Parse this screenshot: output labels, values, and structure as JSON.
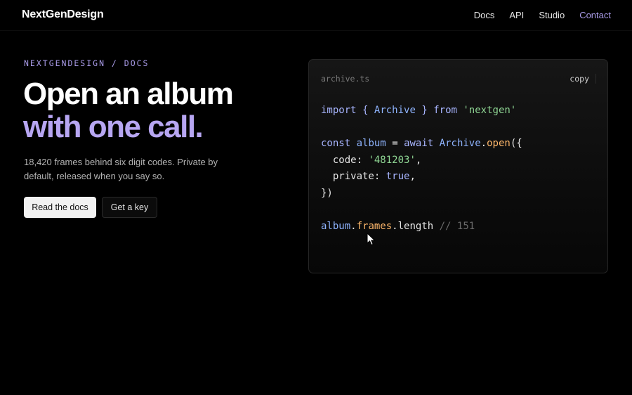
{
  "nav": {
    "brand": "NextGenDesign",
    "links": [
      {
        "label": "Docs"
      },
      {
        "label": "API"
      },
      {
        "label": "Studio"
      },
      {
        "label": "Contact"
      }
    ]
  },
  "hero": {
    "eyebrow": "NEXTGENDESIGN / DOCS",
    "headline_line1": "Open an album",
    "headline_line2": "with one call.",
    "subtitle": "18,420 frames behind six digit codes. Private by default, released when you say so.",
    "primary_button": "Read the docs",
    "secondary_button": "Get a key"
  },
  "code_card": {
    "filename": "archive.ts",
    "copy_label": "copy",
    "tokens": {
      "import": "import",
      "open_brace": "{",
      "archive_1": "Archive",
      "close_brace": "}",
      "from": "from",
      "module": "'nextgen'",
      "const": "const",
      "album_1": "album",
      "eq": "=",
      "await": "await",
      "archive_2": "Archive",
      "dot_1": ".",
      "open": "open",
      "open_call": "({",
      "code_key": "code:",
      "code_val": "'481203'",
      "comma_1": ",",
      "private_key": "private:",
      "true": "true",
      "comma_2": ",",
      "close_call": "})",
      "album_2": "album",
      "dot_2": ".",
      "frames": "frames",
      "length": ".length",
      "comment": "// 151"
    }
  },
  "colors": {
    "accent": "#a99be8",
    "headline_accent": "#b7a6f2",
    "background": "#000000",
    "card_border": "#262626",
    "string": "#8fd694",
    "function": "#ffb86b",
    "identifier": "#8fb4ff"
  },
  "icons": {
    "cursor": "arrow-cursor-icon"
  }
}
